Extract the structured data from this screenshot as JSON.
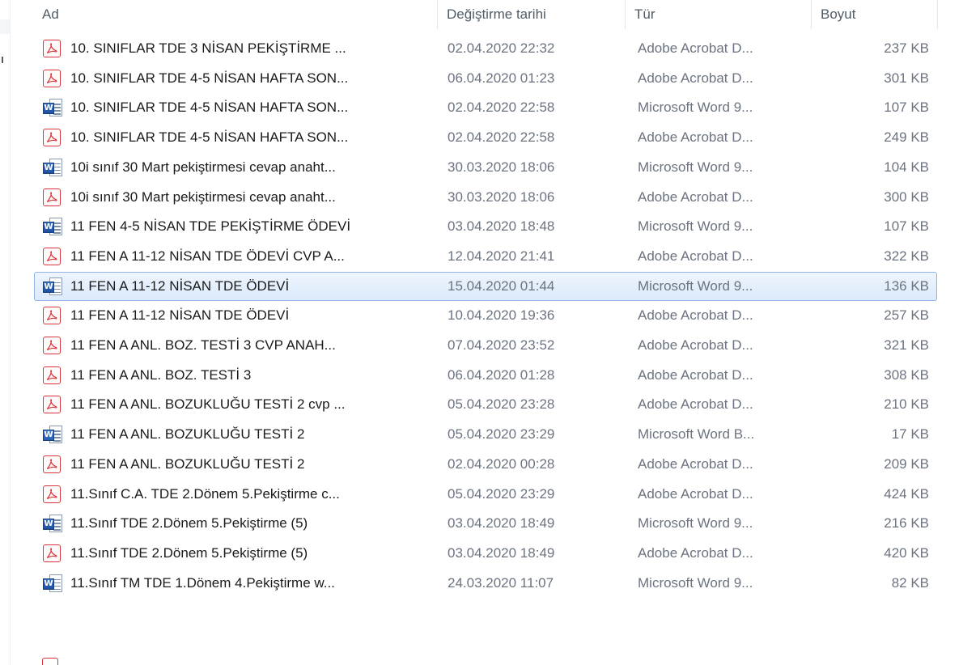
{
  "columns": {
    "name": "Ad",
    "date": "Değiştirme tarihi",
    "type": "Tür",
    "size": "Boyut"
  },
  "colors": {
    "pdf_red": "#d9363e",
    "word_blue": "#2b5fad",
    "selection_bg": "#dbeafb",
    "selection_border": "#8fb4e4"
  },
  "files": [
    {
      "icon": "pdf-icon",
      "name": "10. SINIFLAR TDE  3 NİSAN PEKİŞTİRME  ...",
      "date": "02.04.2020 22:32",
      "type": "Adobe Acrobat D...",
      "size": "237 KB",
      "selected": false
    },
    {
      "icon": "pdf-icon",
      "name": "10. SINIFLAR TDE 4-5 NİSAN HAFTA SON...",
      "date": "06.04.2020 01:23",
      "type": "Adobe Acrobat D...",
      "size": "301 KB",
      "selected": false
    },
    {
      "icon": "word-icon",
      "name": "10. SINIFLAR TDE 4-5 NİSAN HAFTA SON...",
      "date": "02.04.2020 22:58",
      "type": "Microsoft Word 9...",
      "size": "107 KB",
      "selected": false
    },
    {
      "icon": "pdf-icon",
      "name": "10. SINIFLAR TDE 4-5 NİSAN HAFTA SON...",
      "date": "02.04.2020 22:58",
      "type": "Adobe Acrobat D...",
      "size": "249 KB",
      "selected": false
    },
    {
      "icon": "word-icon",
      "name": "10i sınıf 30 Mart pekiştirmesi cevap anaht...",
      "date": "30.03.2020 18:06",
      "type": "Microsoft Word 9...",
      "size": "104 KB",
      "selected": false
    },
    {
      "icon": "pdf-icon",
      "name": "10i sınıf 30 Mart pekiştirmesi cevap anaht...",
      "date": "30.03.2020 18:06",
      "type": "Adobe Acrobat D...",
      "size": "300 KB",
      "selected": false
    },
    {
      "icon": "word-icon",
      "name": "11  FEN 4-5 NİSAN TDE PEKİŞTİRME ÖDEVİ",
      "date": "03.04.2020 18:48",
      "type": "Microsoft Word 9...",
      "size": "107 KB",
      "selected": false
    },
    {
      "icon": "pdf-icon",
      "name": "11 FEN A 11-12 NİSAN TDE ÖDEVİ CVP A...",
      "date": "12.04.2020 21:41",
      "type": "Adobe Acrobat D...",
      "size": "322 KB",
      "selected": false
    },
    {
      "icon": "word-icon",
      "name": "11 FEN A 11-12 NİSAN TDE ÖDEVİ",
      "date": "15.04.2020 01:44",
      "type": "Microsoft Word 9...",
      "size": "136 KB",
      "selected": true
    },
    {
      "icon": "pdf-icon",
      "name": "11 FEN A 11-12 NİSAN TDE ÖDEVİ",
      "date": "10.04.2020 19:36",
      "type": "Adobe Acrobat D...",
      "size": "257 KB",
      "selected": false
    },
    {
      "icon": "pdf-icon",
      "name": "11 FEN A ANL. BOZ. TESTİ  3 CVP ANAH...",
      "date": "07.04.2020 23:52",
      "type": "Adobe Acrobat D...",
      "size": "321 KB",
      "selected": false
    },
    {
      "icon": "pdf-icon",
      "name": "11 FEN A ANL. BOZ. TESTİ  3",
      "date": "06.04.2020 01:28",
      "type": "Adobe Acrobat D...",
      "size": "308 KB",
      "selected": false
    },
    {
      "icon": "pdf-icon",
      "name": "11 FEN A ANL. BOZUKLUĞU TESTİ 2 cvp ...",
      "date": "05.04.2020 23:28",
      "type": "Adobe Acrobat D...",
      "size": "210 KB",
      "selected": false
    },
    {
      "icon": "word-icon",
      "name": "11 FEN A ANL. BOZUKLUĞU TESTİ 2",
      "date": "05.04.2020 23:29",
      "type": "Microsoft Word B...",
      "size": "17 KB",
      "selected": false
    },
    {
      "icon": "pdf-icon",
      "name": "11 FEN A ANL. BOZUKLUĞU TESTİ 2",
      "date": "02.04.2020 00:28",
      "type": "Adobe Acrobat D...",
      "size": "209 KB",
      "selected": false
    },
    {
      "icon": "pdf-icon",
      "name": "11.Sınıf C.A. TDE 2.Dönem 5.Pekiştirme c...",
      "date": "05.04.2020 23:29",
      "type": "Adobe Acrobat D...",
      "size": "424 KB",
      "selected": false
    },
    {
      "icon": "word-icon",
      "name": "11.Sınıf TDE 2.Dönem 5.Pekiştirme (5)",
      "date": "03.04.2020 18:49",
      "type": "Microsoft Word 9...",
      "size": "216 KB",
      "selected": false
    },
    {
      "icon": "pdf-icon",
      "name": "11.Sınıf TDE 2.Dönem 5.Pekiştirme (5)",
      "date": "03.04.2020 18:49",
      "type": "Adobe Acrobat D...",
      "size": "420 KB",
      "selected": false
    },
    {
      "icon": "word-icon",
      "name": "11.Sınıf TM TDE 1.Dönem 4.Pekiştirme w...",
      "date": "24.03.2020 11:07",
      "type": "Microsoft Word 9...",
      "size": "82 KB",
      "selected": false
    }
  ]
}
